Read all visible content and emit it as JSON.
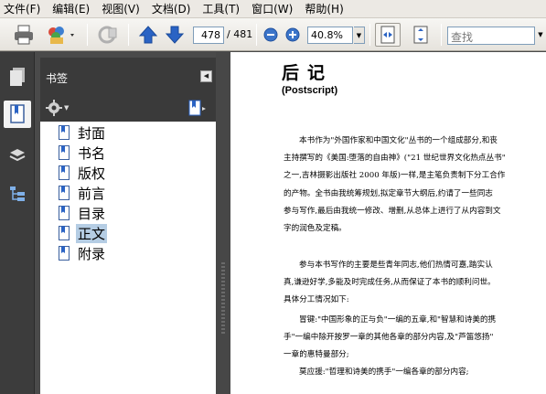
{
  "menu": [
    "文件(F)",
    "编辑(E)",
    "视图(V)",
    "文档(D)",
    "工具(T)",
    "窗口(W)",
    "帮助(H)"
  ],
  "toolbar": {
    "current_page": "478",
    "total_pages": "/ 481",
    "zoom": "40.8%",
    "find_placeholder": "查找"
  },
  "panel": {
    "title": "书签",
    "bookmarks": [
      "封面",
      "书名",
      "版权",
      "前言",
      "目录",
      "正文",
      "附录"
    ],
    "selected_index": 5
  },
  "document": {
    "title": "后记",
    "subtitle": "(Postscript)",
    "paragraphs": [
      [
        "本书作为\"外国作家和中国文化\"丛书的一个组成部分,和丧",
        "主持撰写的《美国:堕落的自由神》(\"21 世纪世界文化热点丛书\"",
        "之一,吉林摄影出版社 2000 年版)一样,是主笔负责制下分工合作",
        "的产物。全书由我统筹规划,拟定章节大纲后,约请了一些同志",
        "参与写作,最后由我统一修改、增删,从总体上进行了从内容到文",
        "字的润色及定稿。"
      ],
      [
        "参与本书写作的主要是些青年同志,他们热情可嘉,踏实认",
        "真,谦逊好学,多能及时完成任务,从而保证了本书的顺利问世。",
        "具体分工情况如下:"
      ],
      [
        "冒键:\"中国形象的正与负\"一编的五章,和\"智慧和诗美的携",
        "手\"一编中除开按罗一章的其他各章的部分内容,及\"芦笛悠扬\"",
        "一章的惠特曼部分;"
      ],
      [
        "莫应援:\"哲理和诗美的携手\"一编各章的部分内容;"
      ]
    ]
  },
  "colors": {
    "selection": "#b5cde4",
    "panel_dark": "#3a3a3a",
    "accent_blue": "#2a63c4"
  }
}
